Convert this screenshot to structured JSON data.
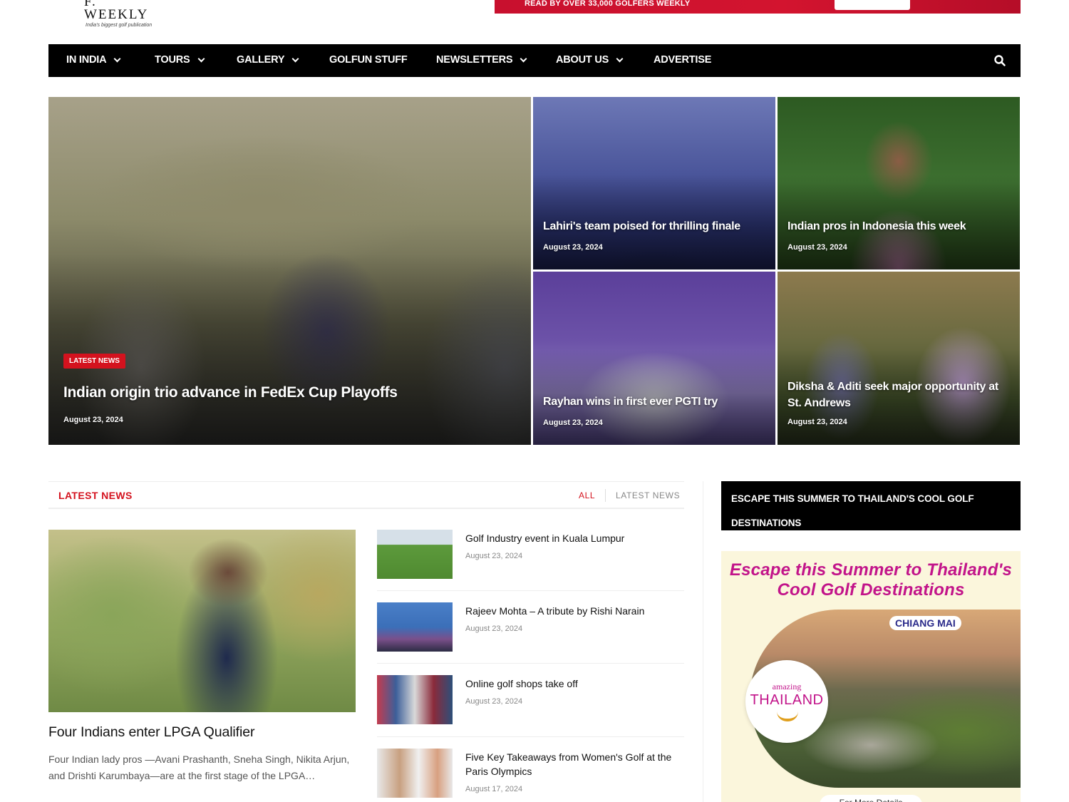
{
  "logo": {
    "word": "F. WEEKLY",
    "tagline": "India's biggest golf publication"
  },
  "top_banner": {
    "text": "READ BY OVER 33,000 GOLFERS WEEKLY"
  },
  "nav": {
    "items": [
      {
        "label": "IN INDIA",
        "dropdown": true
      },
      {
        "label": "TOURS",
        "dropdown": true
      },
      {
        "label": "GALLERY",
        "dropdown": true
      },
      {
        "label": "GOLFUN STUFF",
        "dropdown": false
      },
      {
        "label": "NEWSLETTERS",
        "dropdown": true
      },
      {
        "label": "ABOUT US",
        "dropdown": true
      },
      {
        "label": "ADVERTISE",
        "dropdown": false
      }
    ],
    "search_icon": "search-icon"
  },
  "hero": {
    "main": {
      "badge": "LATEST NEWS",
      "title": "Indian origin trio advance in FedEx Cup Playoffs",
      "date": "August 23, 2024"
    },
    "tiles": [
      {
        "title": "Lahiri's team poised for thrilling finale",
        "date": "August 23, 2024"
      },
      {
        "title": "Indian pros in Indonesia this week",
        "date": "August 23, 2024"
      },
      {
        "title": "Rayhan wins in first ever PGTI try",
        "date": "August 23, 2024"
      },
      {
        "title": "Diksha & Aditi seek major opportunity at St. Andrews",
        "date": "August 23, 2024"
      }
    ]
  },
  "latest": {
    "title": "LATEST NEWS",
    "tabs": [
      "ALL",
      "LATEST NEWS"
    ],
    "featured": {
      "title": "Four Indians enter LPGA Qualifier",
      "excerpt": "Four Indian lady pros —Avani Prashanth, Sneha Singh, Nikita Arjun, and Drishti Karumbaya—are at the first stage of the LPGA…"
    },
    "list": [
      {
        "title": "Golf Industry event in Kuala Lumpur",
        "date": "August 23, 2024"
      },
      {
        "title": "Rajeev Mohta – A tribute by Rishi Narain",
        "date": "August 23, 2024"
      },
      {
        "title": "Online golf shops take off",
        "date": "August 23, 2024"
      },
      {
        "title": "Five Key Takeaways from Women's Golf at the Paris Olympics",
        "date": "August 17, 2024"
      }
    ]
  },
  "sidebar": {
    "heading": "ESCAPE THIS SUMMER TO THAILAND'S COOL GOLF DESTINATIONS",
    "ad": {
      "title_line1": "Escape this Summer to Thailand's",
      "title_line2": "Cool Golf Destinations",
      "chip": "CHIANG MAI",
      "brand_small": "amazing",
      "brand_big": "THAILAND",
      "more": "For More Details"
    }
  },
  "colors": {
    "accent": "#d4121e",
    "nav_bg": "#000000",
    "ad_magenta": "#c2148a",
    "banner_red": "#c8102e"
  }
}
